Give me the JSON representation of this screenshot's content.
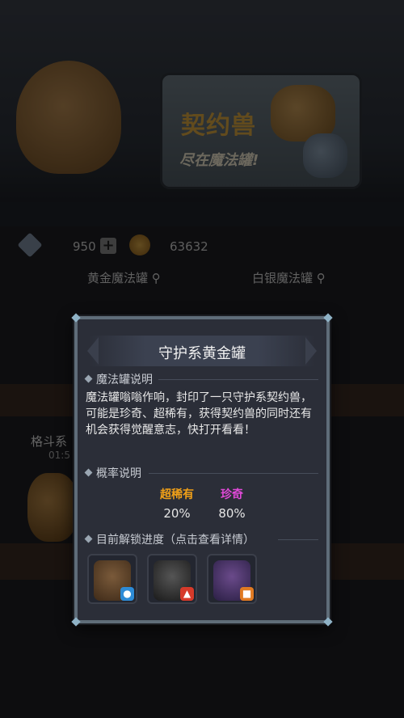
{
  "background": {
    "banner_title": "契约兽",
    "banner_subtitle": "尽在魔法罐!",
    "currency_gems": "950",
    "currency_gold": "63632",
    "tab_gold": "黄金魔法罐",
    "tab_silver": "白银魔法罐",
    "search_icon": "search-icon",
    "left_label": "格斗系",
    "left_time": "01:5"
  },
  "modal": {
    "title": "守护系黄金罐",
    "section_description": {
      "heading": "魔法罐说明",
      "text": "魔法罐嗡嗡作响，封印了一只守护系契约兽，可能是珍奇、超稀有，获得契约兽的同时还有机会获得觉醒意志，快打开看看！"
    },
    "section_probability": {
      "heading": "概率说明",
      "rates": [
        {
          "label": "超稀有",
          "value": "20%",
          "color": "#f0a018"
        },
        {
          "label": "珍奇",
          "value": "80%",
          "color": "#e04ad8"
        }
      ]
    },
    "section_progress": {
      "heading": "目前解锁进度（点击查看详情）",
      "creatures": [
        {
          "name": "tree-guardian",
          "element_icon": "water-drop-icon",
          "badge_color": "#2d8bd6"
        },
        {
          "name": "dark-beast",
          "element_icon": "fire-icon",
          "badge_color": "#d63a2a"
        },
        {
          "name": "blue-mage",
          "element_icon": "earth-icon",
          "badge_color": "#e07a22"
        }
      ]
    }
  }
}
